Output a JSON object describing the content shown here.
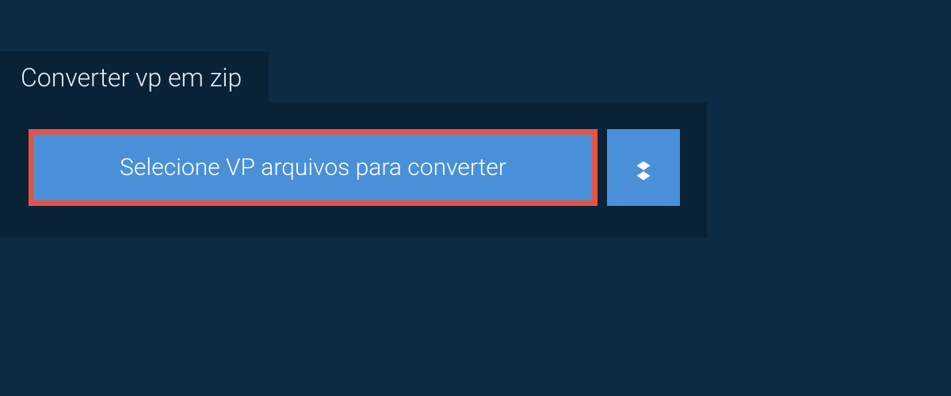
{
  "tab": {
    "title": "Converter vp em zip"
  },
  "actions": {
    "select_label": "Selecione VP arquivos para converter"
  },
  "colors": {
    "background": "#0d2b45",
    "panel": "#0a2236",
    "button": "#4a90d9",
    "highlight_border": "#e15548",
    "text_light": "#ffffff"
  }
}
